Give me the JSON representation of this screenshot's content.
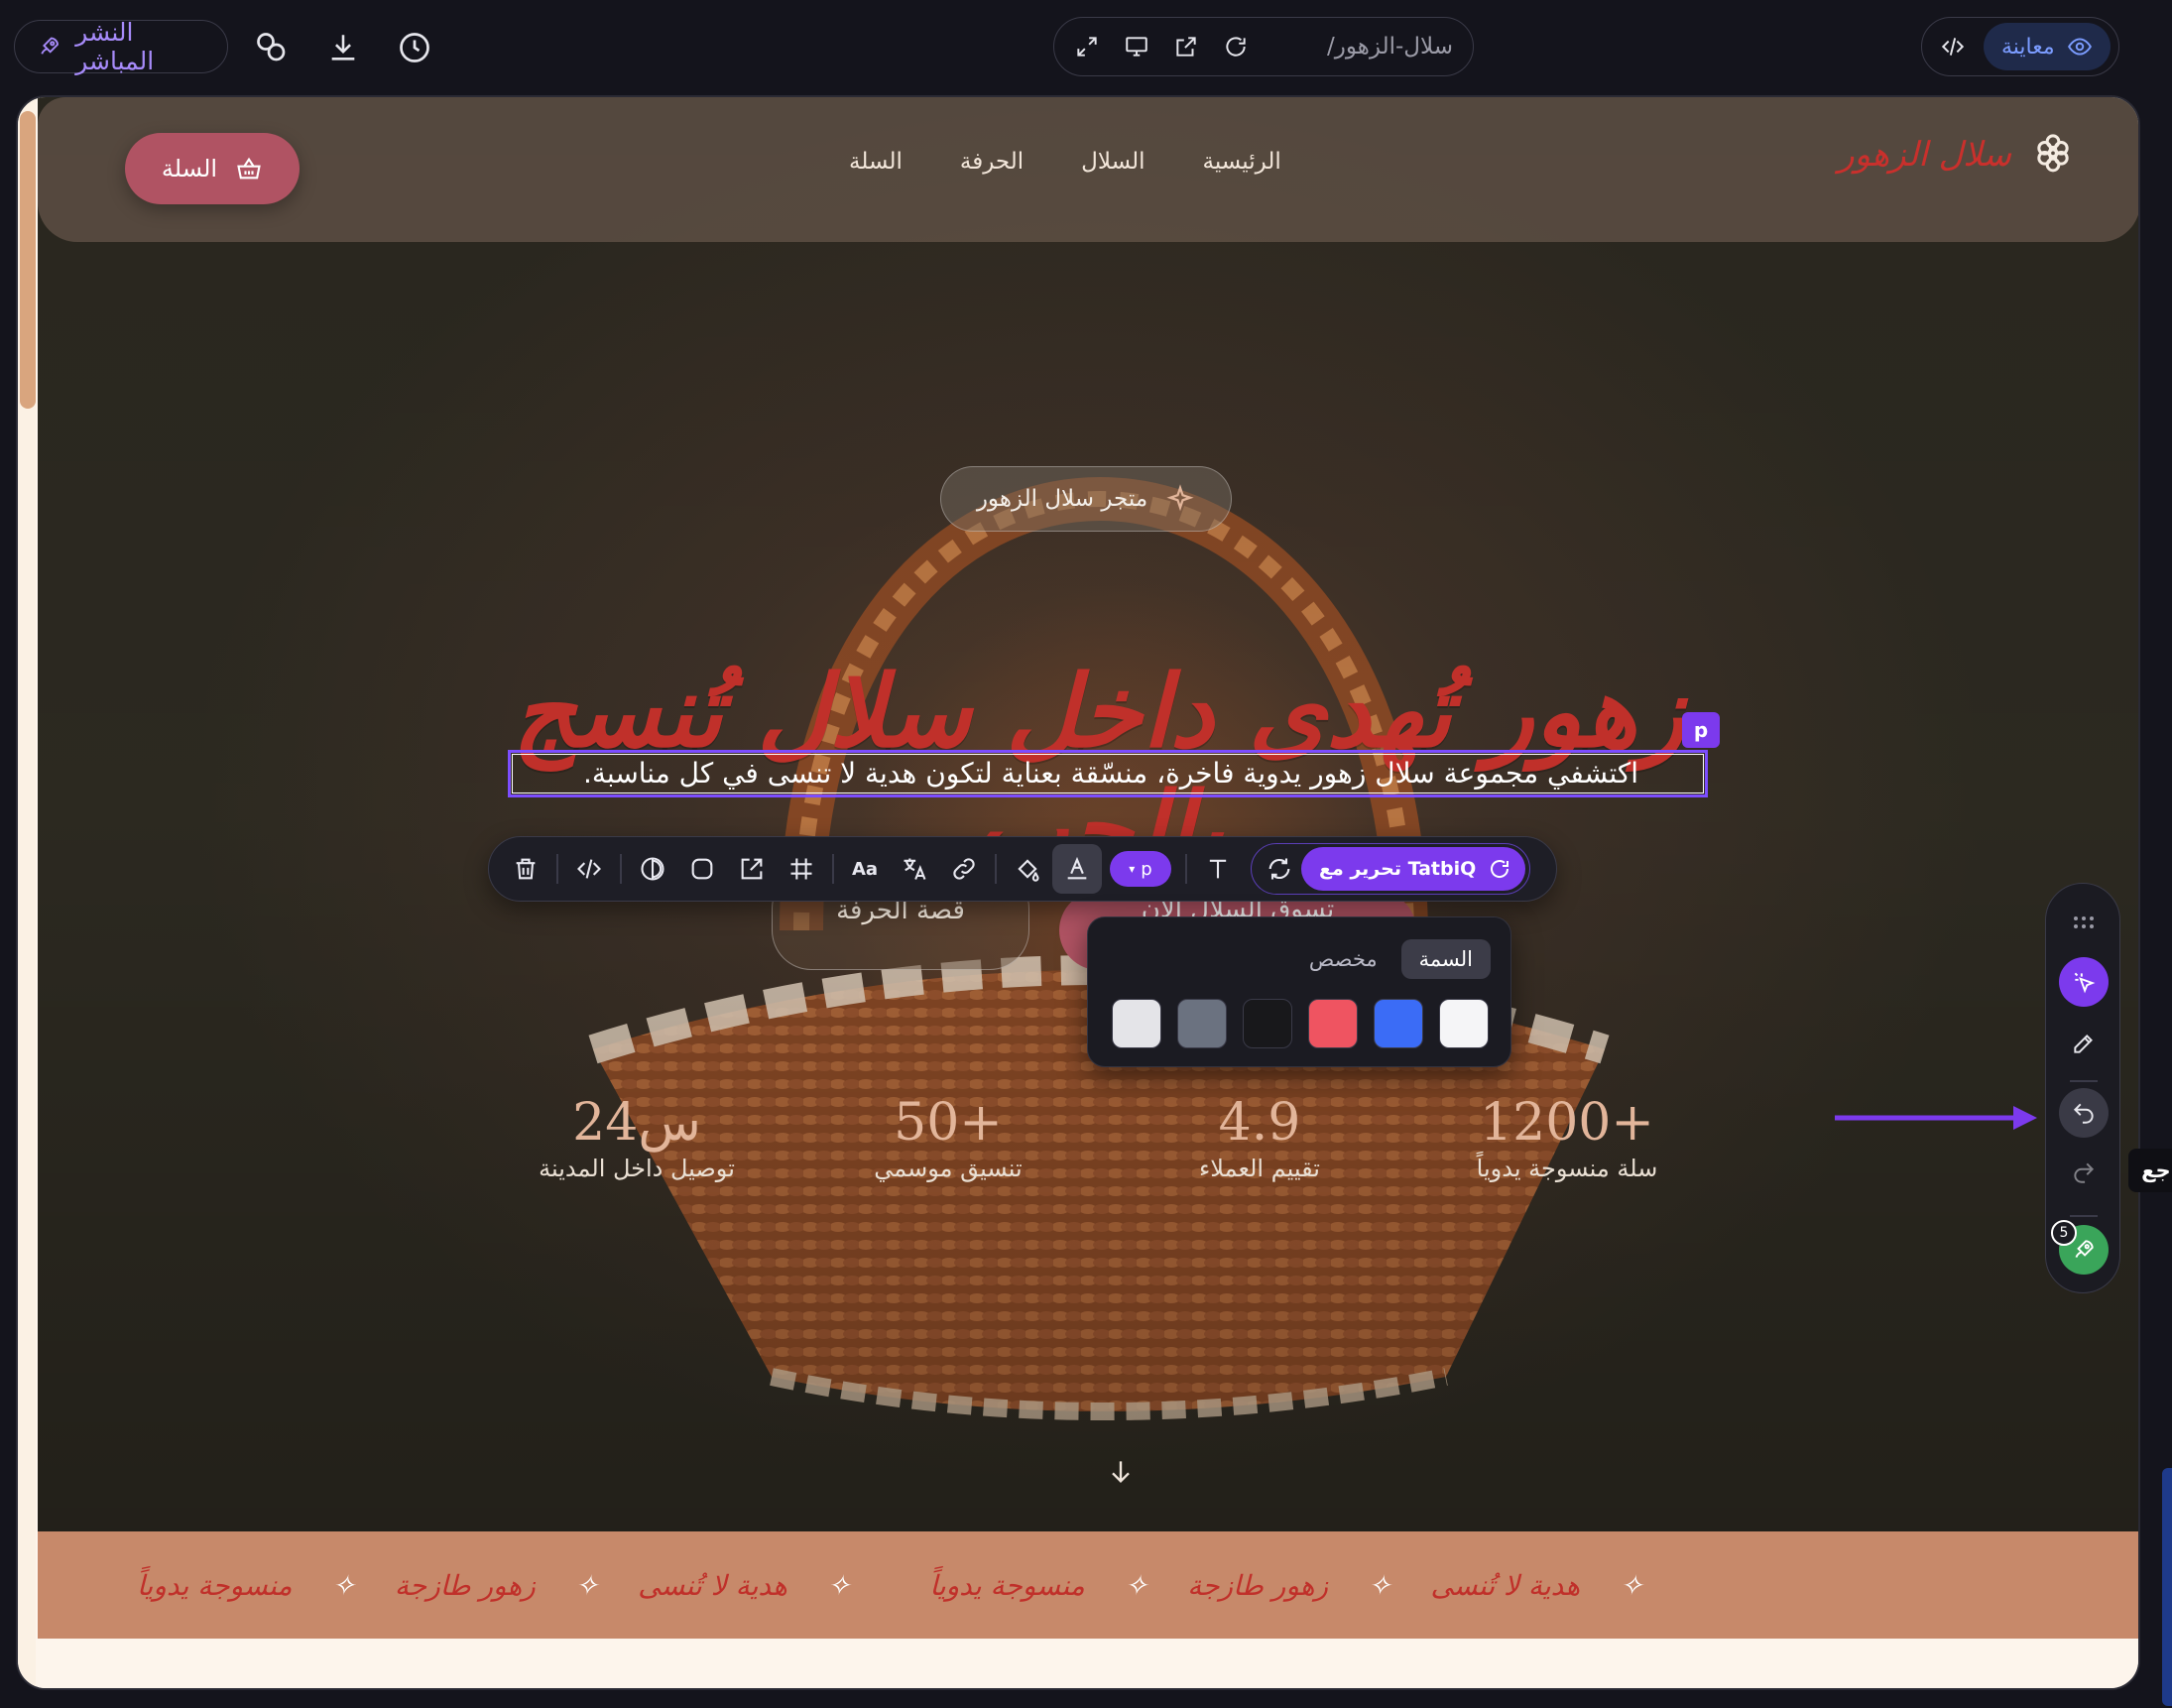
{
  "topbar": {
    "publish_label": "النشر المباشر",
    "url": "/سلال-الزهور",
    "preview_label": "معاينة"
  },
  "site": {
    "logo_text": "سلال الزهور",
    "nav": [
      "الرئيسية",
      "السلال",
      "الحرفة",
      "السلة"
    ],
    "cart_label": "السلة",
    "badge": "متجر سلال الزهور",
    "headline": "زهور تُهدى داخل سلال تُنسج بالحب",
    "subtitle": "اكتشفي مجموعة سلال زهور يدوية فاخرة، منسّقة بعناية لتكون هدية لا تنسى في كل مناسبة.",
    "cta_primary": "تسوق السلال الآن",
    "cta_secondary": "قصة الحرفة",
    "stats": [
      {
        "value": "1200+",
        "label": "سلة منسوجة يدوياً"
      },
      {
        "value": "4.9",
        "label": "تقييم العملاء"
      },
      {
        "value": "50+",
        "label": "تنسيق موسمي"
      },
      {
        "value": "24س",
        "label": "توصيل داخل المدينة"
      }
    ],
    "marquee": [
      "منسوجة يدوياً",
      "زهور طازجة",
      "هدية لا تُنسى",
      "منسوجة يدوياً",
      "زهور طازجة",
      "هدية لا تُنسى"
    ]
  },
  "editor": {
    "selected_tag": "p",
    "element_type": "p",
    "tatbiq_label": "تحرير مع TatbiQ",
    "color_tabs": {
      "theme": "السمة",
      "custom": "مخصص"
    },
    "swatches": [
      "#e4e4e8",
      "#6b7280",
      "#18181b",
      "#ef5461",
      "#3b6cf6",
      "#f5f5f7"
    ],
    "undo_tooltip": "تراجع",
    "pending_count": "5"
  },
  "colors": {
    "accent": "#7c3aed",
    "brand_red": "#c0302a",
    "cart_pink": "#b05363",
    "marquee_bg": "#c7896a"
  }
}
